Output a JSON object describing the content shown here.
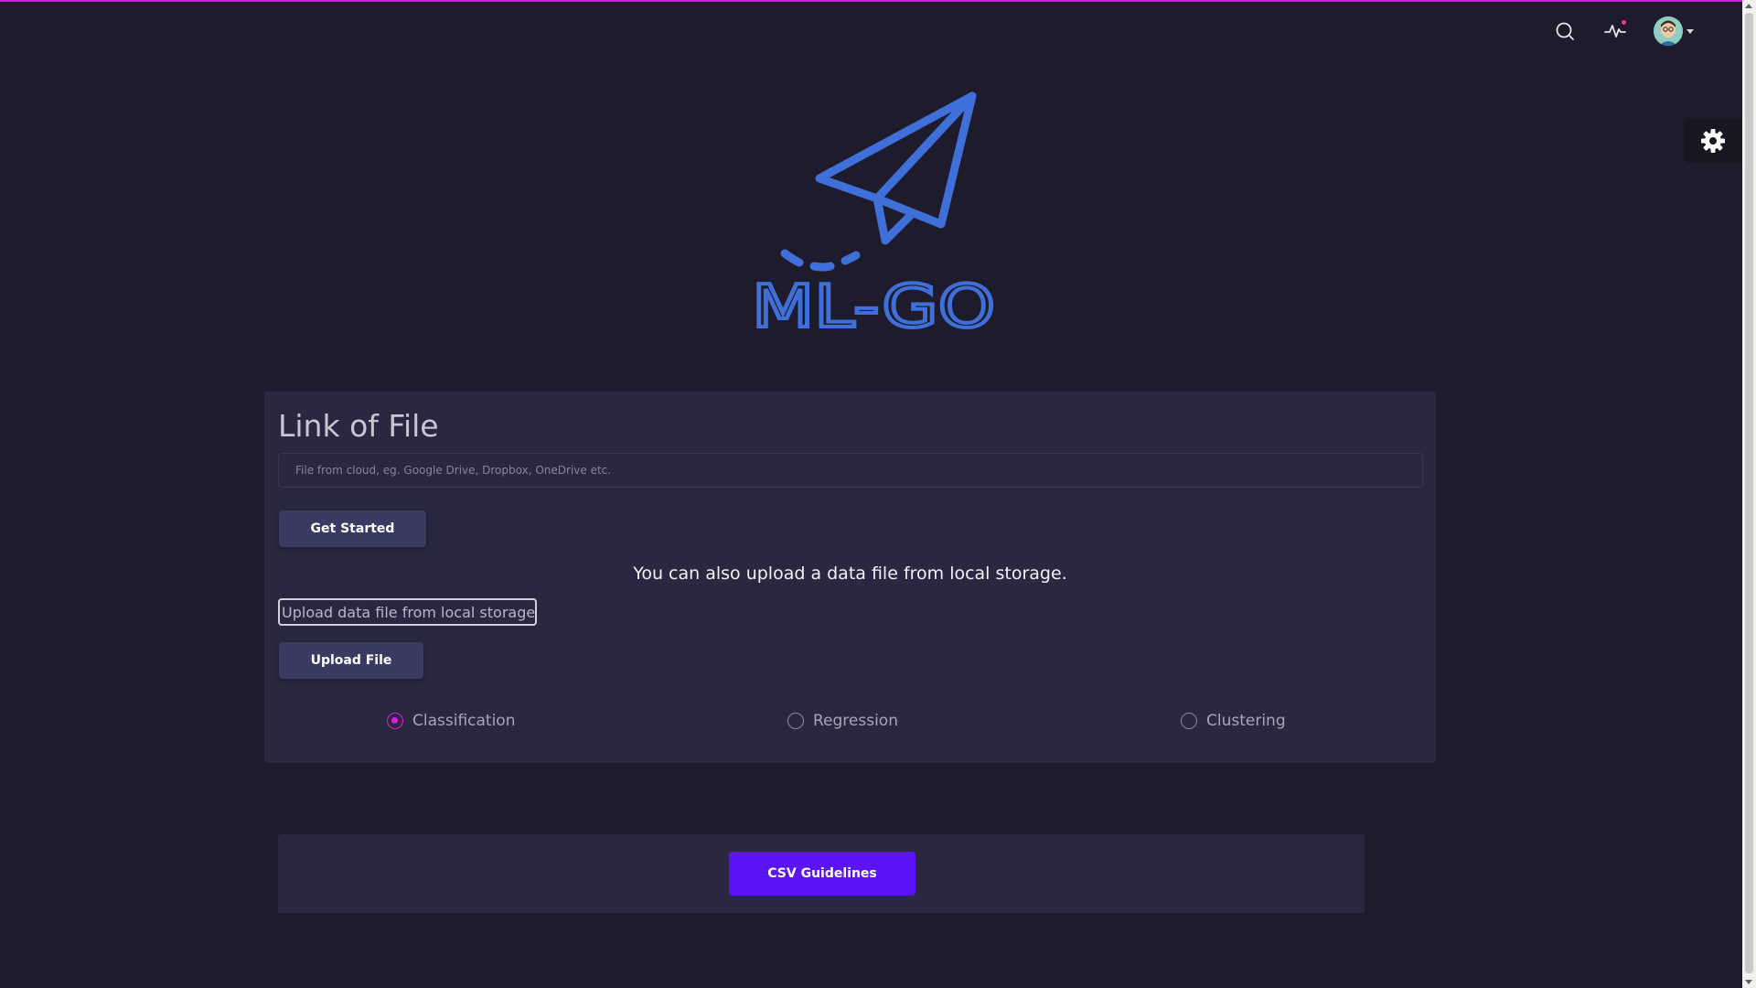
{
  "app": {
    "logo_text": "ML-GO"
  },
  "navbar": {
    "search_icon": "search-icon",
    "activity_icon": "activity-icon",
    "user_icon": "avatar",
    "has_notification": true
  },
  "settings": {
    "icon": "gear-icon"
  },
  "upload_card": {
    "title": "Link of File",
    "link_placeholder": "File from cloud, eg. Google Drive, Dropbox, OneDrive etc.",
    "get_started_label": "Get Started",
    "upload_note": "You can also upload a data file from local storage.",
    "file_picker_label": "Upload data file from local storage",
    "upload_button_label": "Upload File",
    "task_options": [
      {
        "label": "Classification",
        "selected": true
      },
      {
        "label": "Regression",
        "selected": false
      },
      {
        "label": "Clustering",
        "selected": false
      }
    ]
  },
  "guidelines": {
    "button_label": "CSV Guidelines"
  },
  "colors": {
    "accent": "#e01ad6",
    "primary_button": "#5b14f5",
    "logo_blue": "#3f6fd8",
    "background": "#1e1c2c",
    "card": "#2a2740"
  }
}
